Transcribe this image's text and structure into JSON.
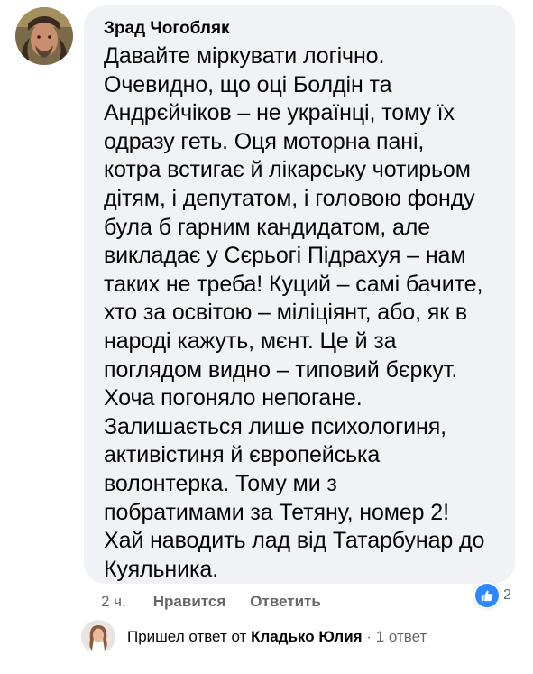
{
  "comment": {
    "author": "Зрад Чогобляк",
    "lines": [
      "Давайте міркувати логічно.",
      "Очевидно, що оці Болдін та",
      "Андрєйчіков – не українці, тому їх",
      "одразу геть. Оця моторна пані,",
      "котра встигає й лікарську чотирьом",
      "дітям, і депутатом, і головою фонду",
      "була б гарним кандидатом, але",
      "викладає у Сєрьогі Підрахуя – нам",
      "таких не треба! Куций – самі бачите,",
      "хто за освітою – міліціянт, або, як в",
      "народі кажуть, мєнт. Це й за",
      "поглядом видно – типовий бєркут.",
      "Хоча погоняло непогане.",
      "Залишається лише психологиня,",
      "активістиня й європейська",
      "волонтерка. Тому ми з",
      "побратимами за Тетяну, номер 2!",
      "Хай наводить лад від Татарбунар до",
      "Куяльника."
    ]
  },
  "actions": {
    "time": "2 ч.",
    "like_label": "Нравится",
    "reply_label": "Ответить"
  },
  "reactions": {
    "icon": "like-icon",
    "count": "2",
    "color": "#2d88ff"
  },
  "reply_summary": {
    "prefix": "Пришел ответ от",
    "author": "Кладько Юлия",
    "separator": "·",
    "count_text": "1 ответ"
  }
}
